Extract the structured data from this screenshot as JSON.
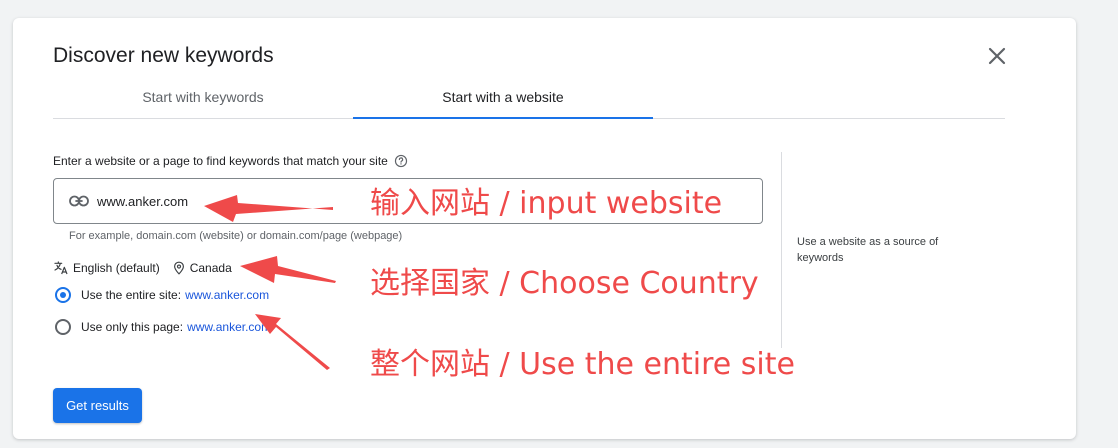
{
  "dialog": {
    "title": "Discover new keywords",
    "tabs": [
      {
        "label": "Start with keywords",
        "active": false
      },
      {
        "label": "Start with a website",
        "active": true
      }
    ],
    "field_label": "Enter a website or a page to find keywords that match your site",
    "input_value": "www.anker.com",
    "hint": "For example, domain.com (website) or domain.com/page (webpage)",
    "language": "English (default)",
    "location": "Canada",
    "radio_options": [
      {
        "prefix": "Use the entire site:",
        "url": "www.anker.com",
        "checked": true
      },
      {
        "prefix": "Use only this page:",
        "url": "www.anker.com",
        "checked": false
      }
    ],
    "side_note": "Use a website as a source of keywords",
    "submit_label": "Get results"
  },
  "annotations": [
    "输入网站 / input website",
    "选择国家 / Choose Country",
    "整个网站 / Use the entire site"
  ],
  "colors": {
    "accent": "#1a73e8",
    "annotation": "#ef4a4a"
  },
  "icons": [
    "close-icon",
    "help-icon",
    "link-icon",
    "translate-icon",
    "location-pin-icon"
  ]
}
